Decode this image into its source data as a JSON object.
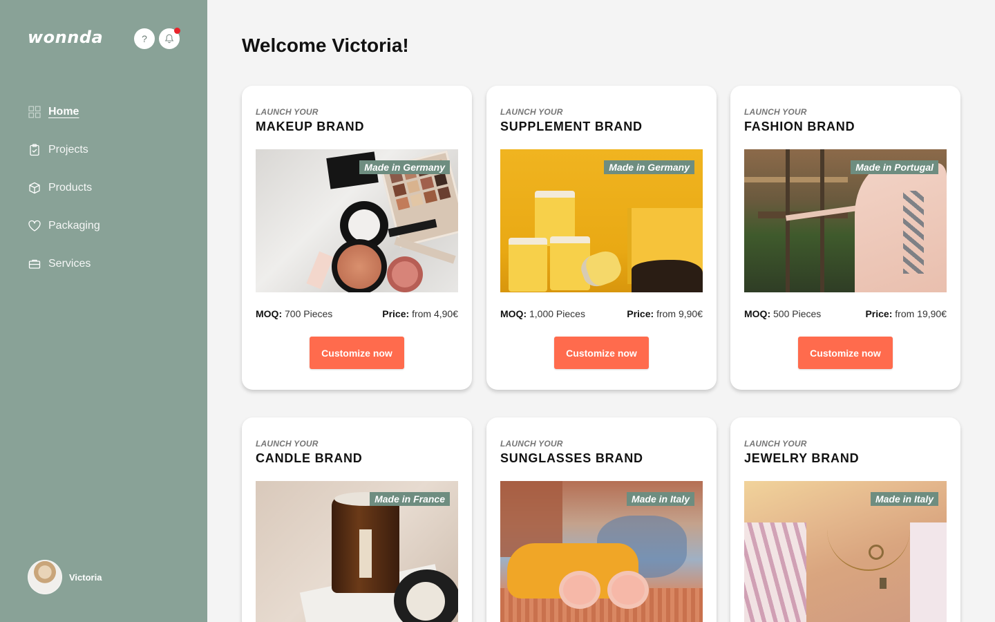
{
  "app": {
    "logo": "wonnda"
  },
  "header": {
    "help_label": "?"
  },
  "sidebar": {
    "items": [
      {
        "label": "Home",
        "icon": "grid-icon",
        "active": true
      },
      {
        "label": "Projects",
        "icon": "clipboard-check-icon"
      },
      {
        "label": "Products",
        "icon": "box-icon"
      },
      {
        "label": "Packaging",
        "icon": "heart-icon"
      },
      {
        "label": "Services",
        "icon": "briefcase-icon"
      }
    ],
    "user": {
      "name": "Victoria"
    }
  },
  "main": {
    "welcome": "Welcome Victoria!",
    "cards": [
      {
        "kicker": "LAUNCH YOUR",
        "brand": "MAKEUP BRAND",
        "origin": "Made in Germany",
        "moq_label": "MOQ:",
        "moq": "700 Pieces",
        "price_label": "Price:",
        "price": "from 4,90€",
        "cta": "Customize now"
      },
      {
        "kicker": "LAUNCH YOUR",
        "brand": "SUPPLEMENT BRAND",
        "origin": "Made in Germany",
        "moq_label": "MOQ:",
        "moq": "1,000 Pieces",
        "price_label": "Price:",
        "price": "from 9,90€",
        "cta": "Customize now"
      },
      {
        "kicker": "LAUNCH YOUR",
        "brand": "FASHION BRAND",
        "origin": "Made in Portugal",
        "moq_label": "MOQ:",
        "moq": "500 Pieces",
        "price_label": "Price:",
        "price": "from 19,90€",
        "cta": "Customize now"
      },
      {
        "kicker": "LAUNCH YOUR",
        "brand": "CANDLE BRAND",
        "origin": "Made in France"
      },
      {
        "kicker": "LAUNCH YOUR",
        "brand": "SUNGLASSES BRAND",
        "origin": "Made in Italy"
      },
      {
        "kicker": "LAUNCH YOUR",
        "brand": "JEWELRY BRAND",
        "origin": "Made in Italy"
      }
    ]
  },
  "colors": {
    "sidebar": "#89a297",
    "accent": "#ff6b4d",
    "badge": "#6e8d80",
    "notification": "#e8242b"
  }
}
